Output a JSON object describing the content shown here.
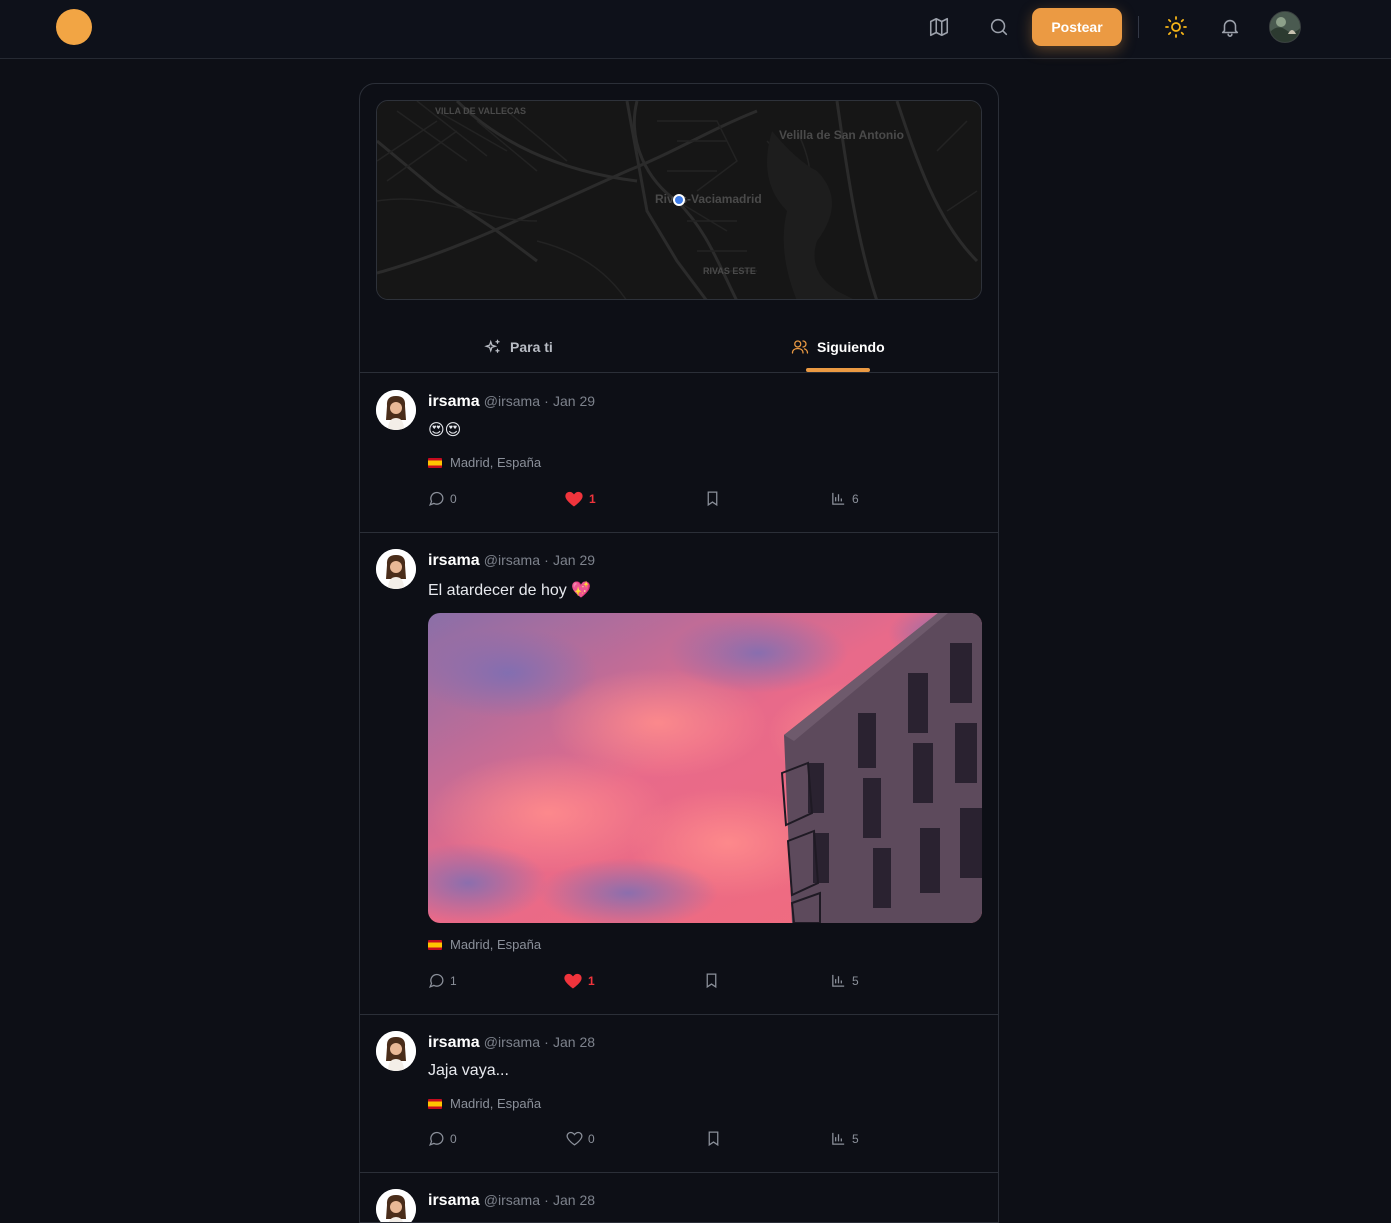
{
  "header": {
    "post_button": "Postear",
    "icons": [
      "map-icon",
      "search-icon",
      "sun-icon",
      "bell-icon"
    ],
    "accent_color": "#eb9a43"
  },
  "map": {
    "labels": [
      "VILLA DE VALLECAS",
      "Velilla de San Antonio",
      "Rivas-Vaciamadrid",
      "RIVAS ESTE"
    ]
  },
  "tabs": [
    {
      "label": "Para ti",
      "active": false
    },
    {
      "label": "Siguiendo",
      "active": true
    }
  ],
  "posts": [
    {
      "name": "irsama",
      "handle": "@irsama",
      "date": "Jan 29",
      "text": "😍😍",
      "location": "Madrid, España",
      "comments": "0",
      "likes": "1",
      "liked": true,
      "views": "6"
    },
    {
      "name": "irsama",
      "handle": "@irsama",
      "date": "Jan 29",
      "text": "El atardecer de hoy 💖",
      "location": "Madrid, España",
      "comments": "1",
      "likes": "1",
      "liked": true,
      "views": "5"
    },
    {
      "name": "irsama",
      "handle": "@irsama",
      "date": "Jan 28",
      "text": "Jaja vaya...",
      "location": "Madrid, España",
      "comments": "0",
      "likes": "0",
      "liked": false,
      "views": "5"
    },
    {
      "name": "irsama",
      "handle": "@irsama",
      "date": "Jan 28"
    }
  ]
}
